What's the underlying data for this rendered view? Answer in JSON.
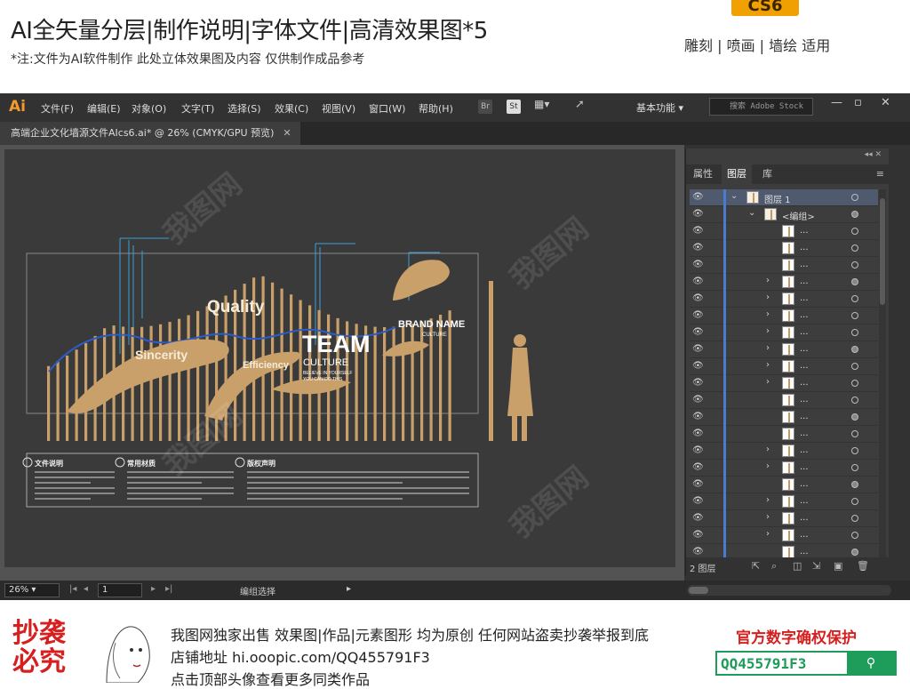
{
  "banner": {
    "title": "AI全矢量分层|制作说明|字体文件|高清效果图*5",
    "note": "*注:文件为AI软件制作 此处立体效果图及内容 仅供制作成品参考",
    "version_badge": "CS6",
    "usage": "雕刻 | 喷画 | 墙绘 适用"
  },
  "app": {
    "logo": "Ai",
    "menus": [
      "文件(F)",
      "编辑(E)",
      "对象(O)",
      "文字(T)",
      "选择(S)",
      "效果(C)",
      "视图(V)",
      "窗口(W)",
      "帮助(H)"
    ],
    "toolbar_icons": [
      "Br",
      "St"
    ],
    "workspace": "基本功能",
    "search_placeholder": "搜索 Adobe Stock",
    "doc_tab": "高端企业文化墙源文件AIcs6.ai* @ 26% (CMYK/GPU 预览)"
  },
  "artwork": {
    "words": {
      "quality": "Quality",
      "sincerity": "Sincerity",
      "efficiency": "Efficiency",
      "team": "TEAM",
      "culture": "CULTURE",
      "slogan1": "BELIEVE IN YOURSELF",
      "slogan2": "YOU CAN DO THIS",
      "brand": "BRAND NAME",
      "brand_sub": "CULTURE"
    },
    "notes": [
      {
        "title": "文件说明"
      },
      {
        "title": "常用材质"
      },
      {
        "title": "版权声明"
      }
    ]
  },
  "layers_panel": {
    "tabs": [
      "属性",
      "图层",
      "库"
    ],
    "active_tab": "图层",
    "rows": [
      {
        "name": "图层 1",
        "level": 0,
        "expanded": true,
        "selected": true
      },
      {
        "name": "<编组>",
        "level": 1,
        "expanded": true
      },
      {
        "name": "...",
        "level": 2
      },
      {
        "name": "...",
        "level": 2
      },
      {
        "name": "...",
        "level": 2
      },
      {
        "name": "...",
        "level": 2,
        "has_children": true
      },
      {
        "name": "...",
        "level": 2,
        "has_children": true
      },
      {
        "name": "...",
        "level": 2,
        "has_children": true
      },
      {
        "name": "...",
        "level": 2,
        "has_children": true
      },
      {
        "name": "...",
        "level": 2,
        "has_children": true
      },
      {
        "name": "...",
        "level": 2,
        "has_children": true
      },
      {
        "name": "...",
        "level": 2,
        "has_children": true
      },
      {
        "name": "...",
        "level": 2
      },
      {
        "name": "...",
        "level": 2
      },
      {
        "name": "...",
        "level": 2
      },
      {
        "name": "...",
        "level": 2,
        "has_children": true
      },
      {
        "name": "...",
        "level": 2,
        "has_children": true
      },
      {
        "name": "...",
        "level": 2
      },
      {
        "name": "...",
        "level": 2,
        "has_children": true
      },
      {
        "name": "...",
        "level": 2,
        "has_children": true
      },
      {
        "name": "...",
        "level": 2,
        "has_children": true
      },
      {
        "name": "...",
        "level": 2
      }
    ],
    "layer_count": "2 图层"
  },
  "status": {
    "zoom": "26%",
    "page": "1",
    "selection": "编组选择"
  },
  "footer": {
    "stamp": "抄袭必究",
    "line1": "我图网独家出售 效果图|作品|元素图形 均为原创 任何网站盗卖抄袭举报到底",
    "line2": "店铺地址 hi.ooopic.com/QQ455791F3",
    "line3": "点击顶部头像查看更多同类作品",
    "protect": "官方数字确权保护",
    "qq": "QQ455791F3"
  }
}
